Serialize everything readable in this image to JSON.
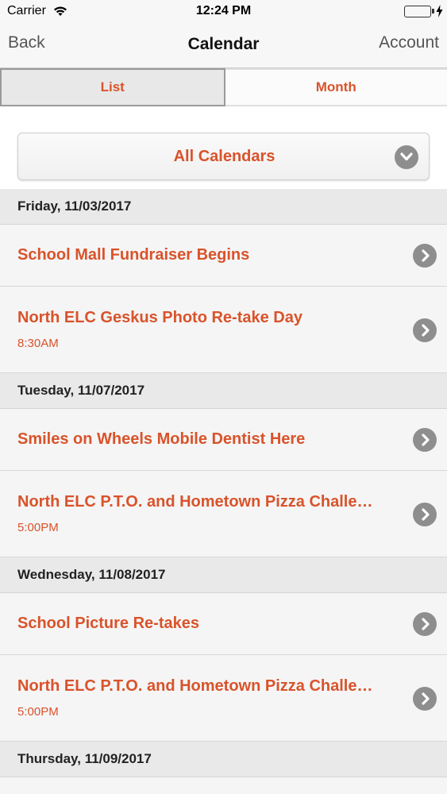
{
  "status_bar": {
    "carrier": "Carrier",
    "time": "12:24 PM",
    "battery_color": "#4cd964"
  },
  "nav": {
    "back_label": "Back",
    "title": "Calendar",
    "account_label": "Account"
  },
  "segments": {
    "list_label": "List",
    "month_label": "Month",
    "selected": "List"
  },
  "filter": {
    "selected_calendar": "All Calendars",
    "icon": "chevron-down-icon"
  },
  "accent_color": "#d9532b",
  "days": [
    {
      "header": "Friday, 11/03/2017",
      "events": [
        {
          "title": "School Mall Fundraiser Begins",
          "time": ""
        },
        {
          "title": "North ELC Geskus Photo Re-take Day",
          "time": "8:30AM"
        }
      ]
    },
    {
      "header": "Tuesday, 11/07/2017",
      "events": [
        {
          "title": "Smiles on Wheels Mobile Dentist Here",
          "time": ""
        },
        {
          "title": "North ELC P.T.O. and Hometown Pizza Challe…",
          "time": "5:00PM"
        }
      ]
    },
    {
      "header": "Wednesday, 11/08/2017",
      "events": [
        {
          "title": "School Picture Re-takes",
          "time": ""
        },
        {
          "title": "North ELC P.T.O. and Hometown Pizza Challe…",
          "time": "5:00PM"
        }
      ]
    },
    {
      "header": "Thursday, 11/09/2017",
      "events": []
    }
  ]
}
